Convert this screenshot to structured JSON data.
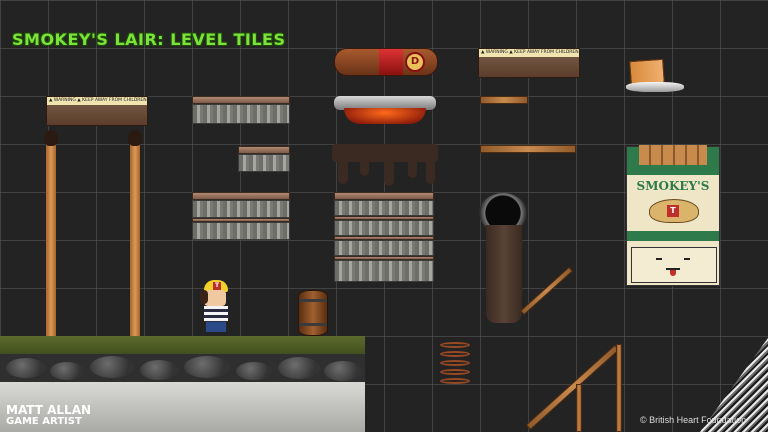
{
  "title": "SMOKEY'S LAIR: LEVEL TILES",
  "credit": {
    "name": "MATT ALLAN",
    "role": "GAME ARTIST"
  },
  "copyright": "© British Heart Foundation",
  "cigar_band": "D",
  "pack": {
    "brand": "SMOKEY'S",
    "badge": "T"
  },
  "character": {
    "cap_letter": "T"
  },
  "label_text": "▲ WARNING ▲ KEEP AWAY FROM CHILDREN",
  "colors": {
    "title_green": "#7be23a",
    "background": "#232323",
    "grid": "#5a5a5a",
    "wood": "#c98a4e",
    "pack_green": "#2e7a4a",
    "pack_cream": "#efe6c8"
  }
}
